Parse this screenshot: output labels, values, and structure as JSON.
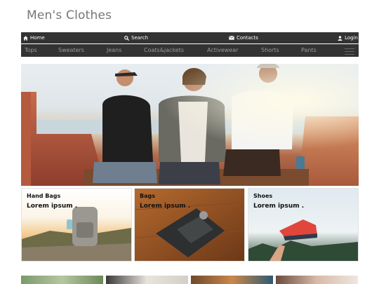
{
  "site": {
    "title": "Men's Clothes"
  },
  "top_nav": {
    "home": "Home",
    "search": "Search",
    "contacts": "Contacts",
    "login": "Login"
  },
  "categories": [
    "Tops",
    "Sweaters",
    "Jeans",
    "Coats&jackets",
    "Activewear",
    "Shorts",
    "Pants"
  ],
  "cards": [
    {
      "title": "Hand Bags",
      "subtitle": "Lorem ipsum ."
    },
    {
      "title": "Bags",
      "subtitle": "Lorem ipsum ."
    },
    {
      "title": "Shoes",
      "subtitle": "Lorem ipsum ."
    }
  ],
  "icons": {
    "home": "home-icon",
    "search": "search-icon",
    "contacts": "envelope-icon",
    "login": "user-icon",
    "menu": "hamburger-menu-icon"
  },
  "colors": {
    "nav_bg": "#333333",
    "nav_text": "#ffffff",
    "category_text": "#9a9a9a",
    "title_text": "#777777"
  }
}
